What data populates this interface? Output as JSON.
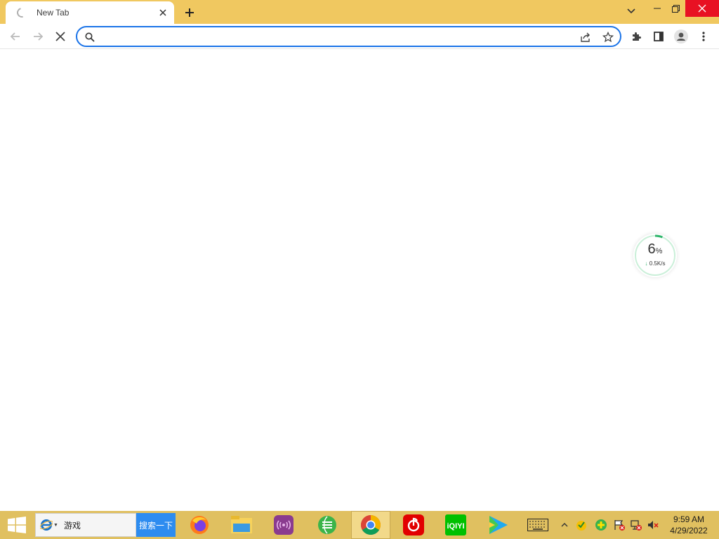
{
  "tab": {
    "title": "New Tab"
  },
  "omnibox": {
    "value": "",
    "placeholder": ""
  },
  "speed_widget": {
    "percent": "6",
    "percent_unit": "%",
    "rate": "0.5K/s",
    "progress": 0.06
  },
  "taskbar": {
    "search_query": "游戏",
    "search_button": "搜索一下",
    "clock_time": "9:59 AM",
    "clock_date": "4/29/2022"
  },
  "colors": {
    "titlebar": "#f0c860",
    "taskbar": "#e0c060",
    "omnibox_border": "#1a73e8",
    "close_button": "#e81123",
    "search_button": "#2d8cf0",
    "speed_green": "#2fb56b"
  },
  "icons": {
    "tab": [
      "loading-spinner-icon",
      "close-icon"
    ],
    "window": [
      "chevron-down-icon",
      "minimize-icon",
      "restore-icon",
      "close-icon"
    ],
    "toolbar": [
      "back-icon",
      "forward-icon",
      "stop-icon",
      "search-icon",
      "share-icon",
      "star-icon",
      "extensions-icon",
      "side-panel-icon",
      "profile-icon",
      "more-icon"
    ],
    "taskbar": [
      "windows-icon",
      "ie-icon",
      "firefox-icon",
      "file-explorer-icon",
      "media-icon",
      "browser-icon",
      "chrome-icon",
      "netease-music-icon",
      "iqiyi-icon",
      "video-player-icon",
      "keyboard-icon"
    ],
    "tray": [
      "chevron-up-icon",
      "security-icon",
      "update-icon",
      "flag-icon",
      "network-icon",
      "volume-muted-icon"
    ]
  }
}
